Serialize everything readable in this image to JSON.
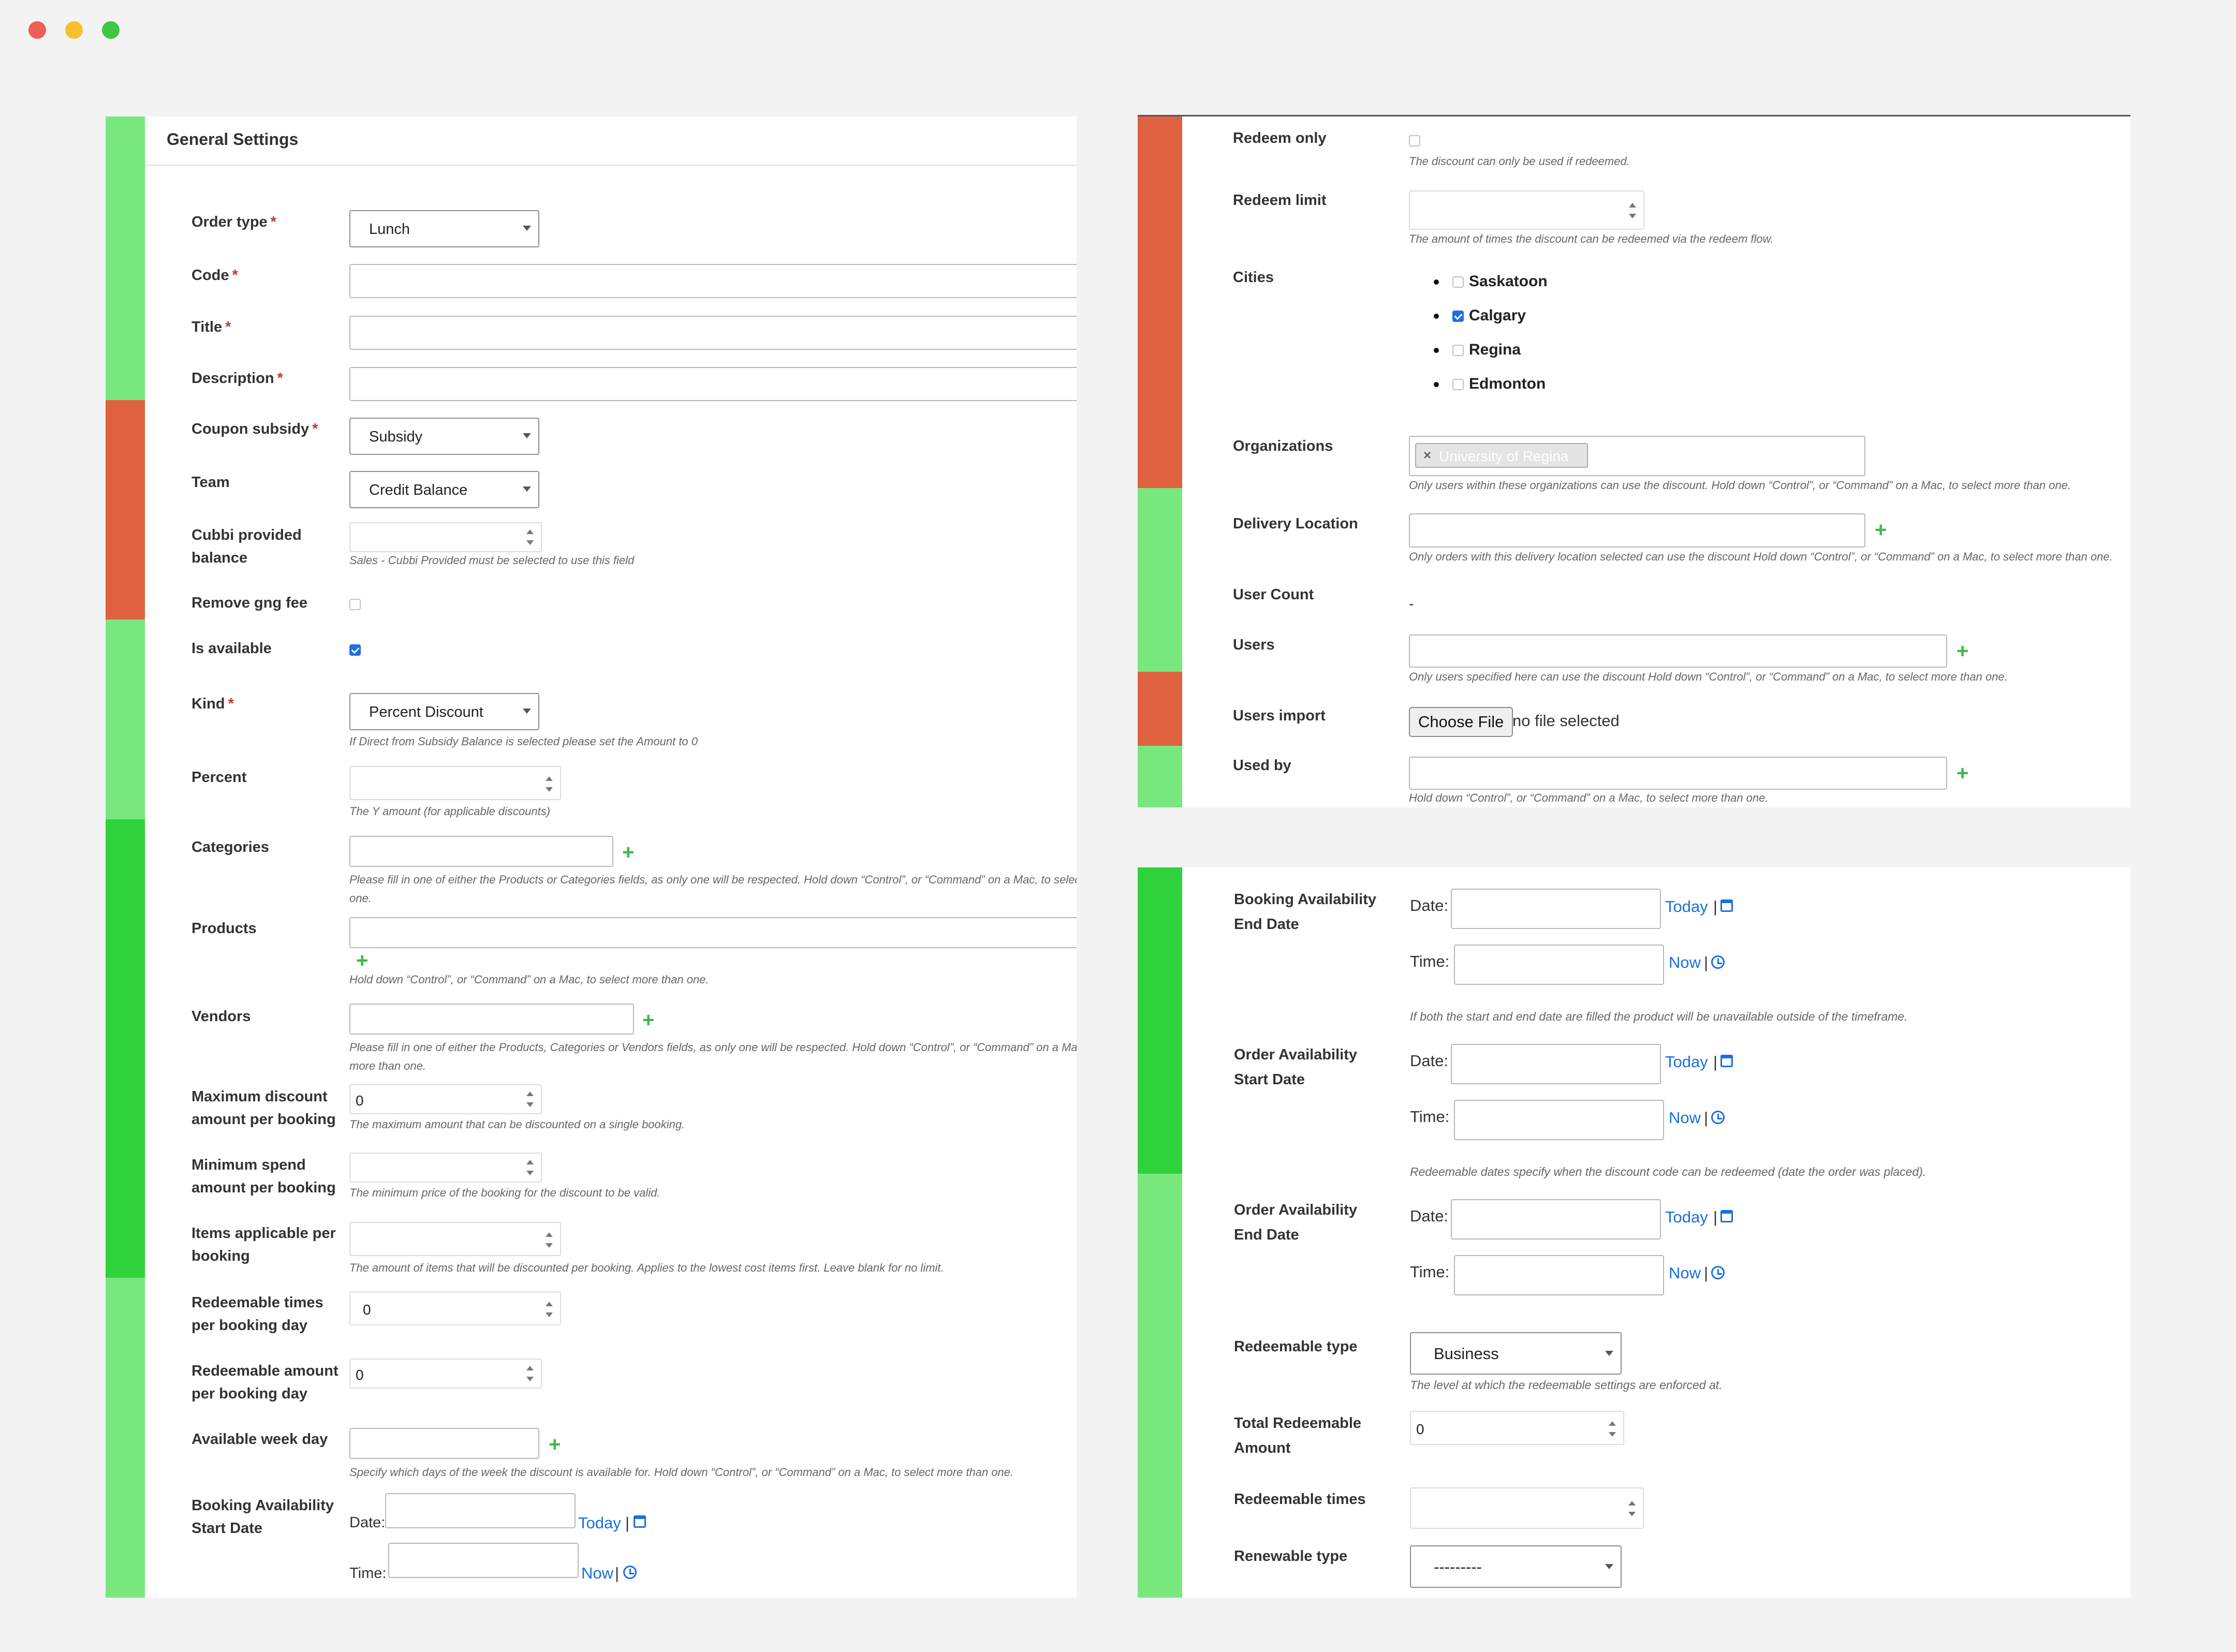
{
  "general": {
    "header": "General Settings",
    "order_type": {
      "label": "Order type",
      "value": "Lunch"
    },
    "code": {
      "label": "Code"
    },
    "title": {
      "label": "Title"
    },
    "description": {
      "label": "Description"
    },
    "coupon_subsidy": {
      "label": "Coupon subsidy",
      "value": "Subsidy"
    },
    "team": {
      "label": "Team",
      "value": "Credit Balance"
    },
    "cubbi_balance": {
      "label_line1": "Cubbi provided",
      "label_line2": "balance",
      "hint": "Sales - Cubbi Provided must be selected to use this field"
    },
    "remove_gng_fee": {
      "label": "Remove gng fee"
    },
    "is_available": {
      "label": "Is available"
    },
    "kind": {
      "label": "Kind",
      "value": "Percent Discount",
      "hint": "If Direct from Subsidy Balance is selected please set the Amount to 0"
    },
    "percent": {
      "label": "Percent",
      "hint": "The Y amount (for applicable discounts)"
    },
    "categories": {
      "label": "Categories",
      "hint_line1": "Please fill in one of either the Products or Categories fields, as only one will be respected. Hold down “Control”, or “Command” on a Mac, to select more than",
      "hint_line2": "one."
    },
    "products": {
      "label": "Products",
      "hint": "Hold down “Control”, or “Command” on a Mac, to select more than one."
    },
    "vendors": {
      "label": "Vendors",
      "hint_line1": "Please fill in one of either the Products, Categories or Vendors fields, as only one will be respected. Hold down “Control”, or “Command” on a Mac, to select",
      "hint_line2": "more than one."
    },
    "max_discount": {
      "label_line1": "Maximum discount",
      "label_line2": "amount per booking",
      "value": "0",
      "hint": "The maximum amount that can be discounted on a single booking."
    },
    "min_spend": {
      "label_line1": "Minimum spend",
      "label_line2": "amount per booking",
      "hint": "The minimum price of the booking for the discount to be valid."
    },
    "items_applicable": {
      "label_line1": "Items applicable per",
      "label_line2": "booking",
      "hint": "The amount of items that will be discounted per booking. Applies to the lowest cost items first. Leave blank for no limit."
    },
    "redeemable_times_day": {
      "label_line1": "Redeemable times",
      "label_line2": "per booking day",
      "value": "0"
    },
    "redeemable_amount_day": {
      "label_line1": "Redeemable amount",
      "label_line2": "per booking day",
      "value": "0"
    },
    "available_week_day": {
      "label": "Available week day",
      "hint": "Specify which days of the week the discount is available for. Hold down “Control”, or “Command” on a Mac, to select more than one."
    },
    "booking_start": {
      "label_line1": "Booking Availability",
      "label_line2": "Start Date",
      "date_label": "Date:",
      "time_label": "Time:",
      "today": "Today",
      "now": "Now",
      "sep": "|"
    }
  },
  "redeem": {
    "redeem_only": {
      "label": "Redeem only",
      "hint": "The discount can only be used if redeemed."
    },
    "redeem_limit": {
      "label": "Redeem limit",
      "hint": "The amount of times the discount can be redeemed via the redeem flow."
    },
    "cities": {
      "label": "Cities",
      "items": [
        {
          "name": "Saskatoon",
          "checked": false
        },
        {
          "name": "Calgary",
          "checked": true
        },
        {
          "name": "Regina",
          "checked": false
        },
        {
          "name": "Edmonton",
          "checked": false
        }
      ]
    },
    "organizations": {
      "label": "Organizations",
      "tag_x": "×",
      "tag": "University of Regina",
      "hint": "Only users within these organizations can use the discount. Hold down “Control”, or “Command” on a Mac, to select more than one."
    },
    "delivery_location": {
      "label": "Delivery Location",
      "hint": "Only orders with this delivery location selected can use the discount Hold down “Control”, or “Command” on a Mac, to select more than one."
    },
    "user_count": {
      "label": "User Count",
      "value": "-"
    },
    "users": {
      "label": "Users",
      "hint": "Only users specified here can use the discount Hold down “Control”, or “Command” on a Mac, to select more than one."
    },
    "users_import": {
      "label": "Users import",
      "button": "Choose File",
      "status": "no file selected"
    },
    "used_by": {
      "label": "Used by",
      "hint": "Hold down “Control”, or “Command” on a Mac, to select more than one."
    }
  },
  "availability": {
    "date_label": "Date:",
    "time_label": "Time:",
    "today": "Today",
    "now": "Now",
    "sep": "|",
    "booking_end": {
      "label_line1": "Booking Availability",
      "label_line2": "End Date",
      "hint": "If both the start and end date are filled the product will be unavailable outside of the timeframe."
    },
    "order_start": {
      "label_line1": "Order Availability",
      "label_line2": "Start Date",
      "hint": "Redeemable dates specify when the discount code can be redeemed (date the order was placed)."
    },
    "order_end": {
      "label_line1": "Order Availability",
      "label_line2": "End Date"
    },
    "redeemable_type": {
      "label": "Redeemable type",
      "value": "Business",
      "hint": "The level at which the redeemable settings are enforced at."
    },
    "total_redeemable": {
      "label_line1": "Total Redeemable",
      "label_line2": "Amount",
      "value": "0"
    },
    "redeemable_times": {
      "label": "Redeemable times"
    },
    "renewable_type": {
      "label": "Renewable type",
      "value": "---------"
    }
  },
  "colors": {
    "light_green": "#78e87e",
    "green": "#2fd23b",
    "red": "#e0613f",
    "link": "#1a6fe0",
    "plus": "#3fb64a"
  }
}
